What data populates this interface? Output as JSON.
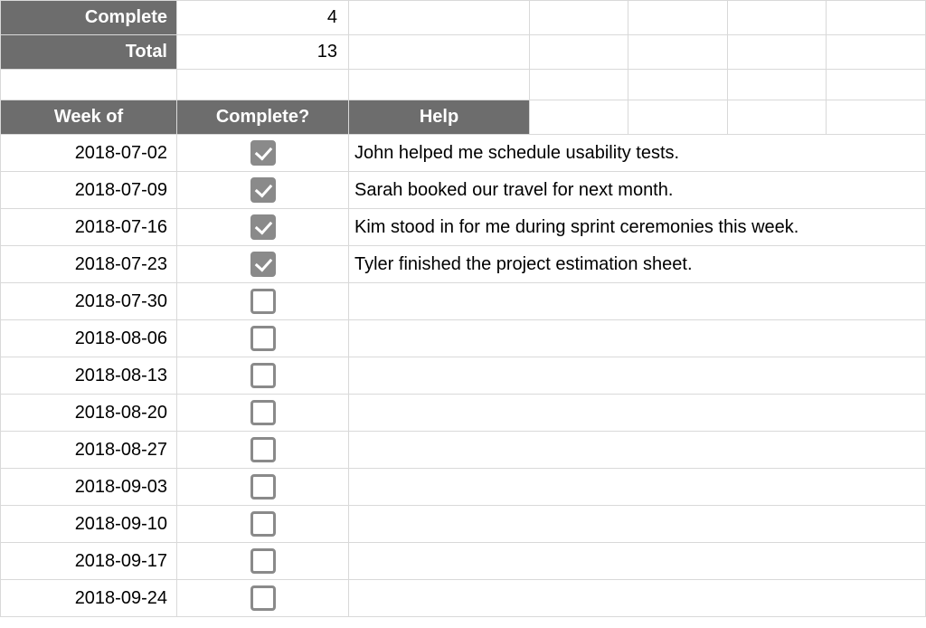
{
  "summary": {
    "complete_label": "Complete",
    "complete_value": "4",
    "total_label": "Total",
    "total_value": "13"
  },
  "headers": {
    "week": "Week of",
    "complete": "Complete?",
    "help": "Help"
  },
  "rows": [
    {
      "date": "2018-07-02",
      "done": true,
      "help": "John helped me schedule usability tests."
    },
    {
      "date": "2018-07-09",
      "done": true,
      "help": "Sarah booked our travel for next month."
    },
    {
      "date": "2018-07-16",
      "done": true,
      "help": "Kim stood in for me during sprint ceremonies this week."
    },
    {
      "date": "2018-07-23",
      "done": true,
      "help": "Tyler finished the project estimation sheet."
    },
    {
      "date": "2018-07-30",
      "done": false,
      "help": ""
    },
    {
      "date": "2018-08-06",
      "done": false,
      "help": ""
    },
    {
      "date": "2018-08-13",
      "done": false,
      "help": ""
    },
    {
      "date": "2018-08-20",
      "done": false,
      "help": ""
    },
    {
      "date": "2018-08-27",
      "done": false,
      "help": ""
    },
    {
      "date": "2018-09-03",
      "done": false,
      "help": ""
    },
    {
      "date": "2018-09-10",
      "done": false,
      "help": ""
    },
    {
      "date": "2018-09-17",
      "done": false,
      "help": ""
    },
    {
      "date": "2018-09-24",
      "done": false,
      "help": ""
    }
  ]
}
